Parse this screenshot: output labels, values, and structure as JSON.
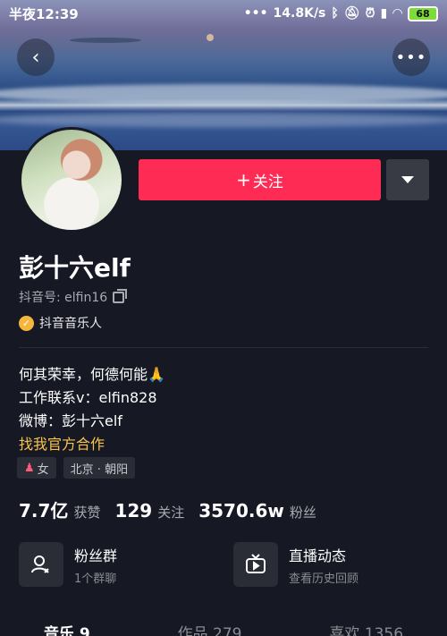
{
  "status_bar": {
    "time": "半夜12:39",
    "speed": "14.8K/s",
    "battery": "68"
  },
  "header": {
    "back_icon": "chevron-left-icon",
    "more_icon": "more-horizontal-icon"
  },
  "actions": {
    "follow_label": "关注",
    "follow_prefix": "+",
    "dropdown_icon": "triangle-down-icon"
  },
  "profile": {
    "name": "彭十六elf",
    "douyin_id": "抖音号: elfin16",
    "verified_label": "抖音音乐人",
    "bio_lines": [
      "何其荣幸，何德何能🙏",
      "工作联系v：elfin828",
      "微博：彭十六elf"
    ],
    "bio_link": "找我官方合作",
    "tags": [
      "女",
      "北京 · 朝阳"
    ]
  },
  "stats": [
    {
      "num": "7.7亿",
      "label": "获赞"
    },
    {
      "num": "129",
      "label": "关注"
    },
    {
      "num": "3570.6w",
      "label": "粉丝"
    }
  ],
  "cards": [
    {
      "title": "粉丝群",
      "sub": "1个群聊",
      "icon": "group-icon"
    },
    {
      "title": "直播动态",
      "sub": "查看历史回顾",
      "icon": "tv-icon"
    }
  ],
  "tabs": [
    "音乐 9",
    "作品 279",
    "喜欢 1356"
  ],
  "colors": {
    "accent": "#fe2c55",
    "background": "#161823",
    "gold": "#f8c34c"
  }
}
